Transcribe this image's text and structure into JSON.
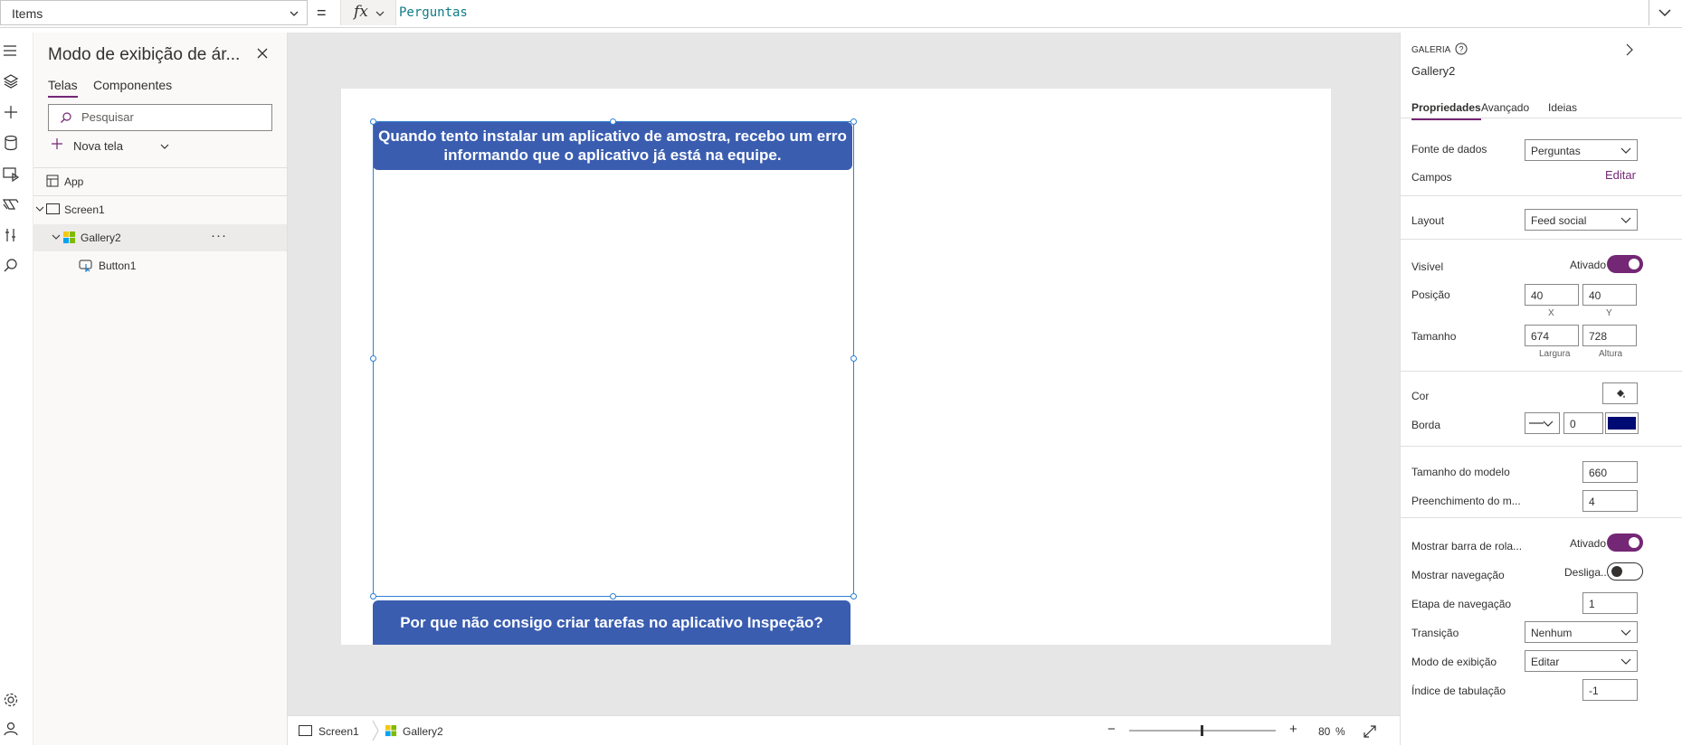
{
  "formula_bar": {
    "property": "Items",
    "equals": "=",
    "fx": "fx",
    "formula": "Perguntas"
  },
  "tree_panel": {
    "title": "Modo de exibição de ár...",
    "tabs": [
      "Telas",
      "Componentes"
    ],
    "search_placeholder": "Pesquisar",
    "new_screen": "Nova tela",
    "items": [
      {
        "label": "App",
        "icon": "app-icon"
      },
      {
        "label": "Screen1",
        "icon": "screen-icon"
      },
      {
        "label": "Gallery2",
        "icon": "gallery-icon",
        "selected": true
      },
      {
        "label": "Button1",
        "icon": "button-icon"
      }
    ],
    "more": "···"
  },
  "canvas": {
    "gallery_items": [
      "Quando tento instalar um aplicativo de amostra, recebo um erro informando que o aplicativo já está na equipe.",
      "Por que não consigo criar tarefas no aplicativo Inspeção?"
    ],
    "accent_color": "#3a5db0"
  },
  "status_bar": {
    "screen": "Screen1",
    "gallery": "Gallery2",
    "zoom_minus": "−",
    "zoom_plus": "+",
    "zoom_value": "80",
    "zoom_unit": "%",
    "zoom_level": 0.5
  },
  "props": {
    "type": "GALERIA",
    "name": "Gallery2",
    "tabs": [
      "Propriedades",
      "Avançado",
      "Ideias"
    ],
    "data_source_label": "Fonte de dados",
    "data_source_value": "Perguntas",
    "fields_label": "Campos",
    "fields_edit": "Editar",
    "layout_label": "Layout",
    "layout_value": "Feed social",
    "visible_label": "Visível",
    "visible_value": "Ativado",
    "position_label": "Posição",
    "pos_x": "40",
    "pos_y": "40",
    "pos_x_label": "X",
    "pos_y_label": "Y",
    "size_label": "Tamanho",
    "width": "674",
    "height": "728",
    "width_label": "Largura",
    "height_label": "Altura",
    "color_label": "Cor",
    "border_label": "Borda",
    "border_value": "0",
    "border_color": "#000a73",
    "template_size_label": "Tamanho do modelo",
    "template_size": "660",
    "template_padding_label": "Preenchimento do m...",
    "template_padding": "4",
    "scrollbar_label": "Mostrar barra de rola...",
    "scrollbar_value": "Ativado",
    "navigation_label": "Mostrar navegação",
    "navigation_value": "Desliga...",
    "nav_step_label": "Etapa de navegação",
    "nav_step": "1",
    "transition_label": "Transição",
    "transition_value": "Nenhum",
    "display_mode_label": "Modo de exibição",
    "display_mode_value": "Editar",
    "tab_index_label": "Índice de tabulação",
    "tab_index": "-1",
    "accent_color": "#742774"
  }
}
